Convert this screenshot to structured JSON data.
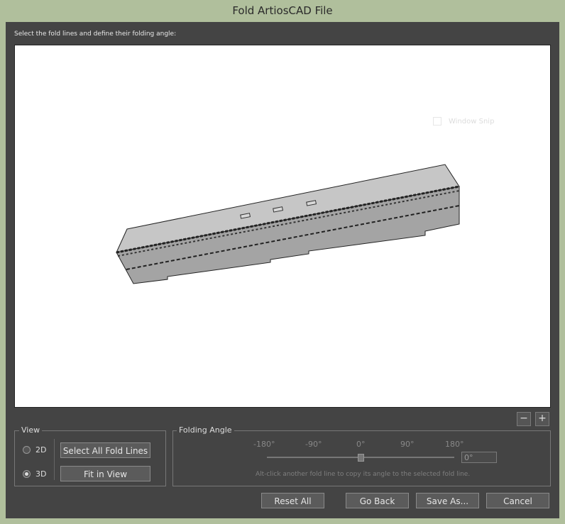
{
  "window": {
    "title": "Fold ArtiosCAD File"
  },
  "canvas": {
    "instruction": "Select the fold lines and define their folding angle:",
    "ghost_label": "Window Snip"
  },
  "zoom": {
    "minus": "−",
    "plus": "+"
  },
  "view": {
    "title": "View",
    "option_2d": "2D",
    "option_3d": "3D",
    "selected": "3D",
    "select_all_label": "Select All Fold Lines",
    "fit_label": "Fit in View"
  },
  "folding": {
    "title": "Folding Angle",
    "ticks": [
      "-180°",
      "-90°",
      "0°",
      "90°",
      "180°"
    ],
    "slider_value_deg": 0,
    "angle_value": "0°",
    "hint": "Alt-click another fold line to copy its angle to the selected fold line."
  },
  "buttons": {
    "reset": "Reset All",
    "back": "Go Back",
    "save": "Save As...",
    "cancel": "Cancel"
  },
  "colors": {
    "frame": "#b0bf9c",
    "client": "#444444",
    "canvas": "#ffffff",
    "model_top": "#c6c6c6",
    "model_side": "#a4a4a4"
  }
}
